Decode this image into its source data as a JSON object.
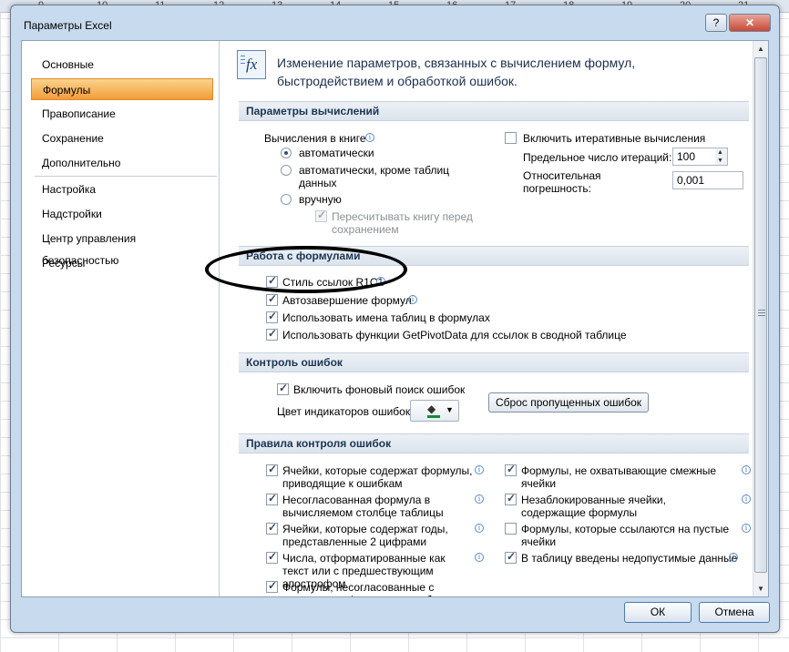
{
  "background": {
    "col_headers": [
      "9",
      "10",
      "11",
      "12",
      "13",
      "14",
      "15",
      "16",
      "17",
      "18",
      "19",
      "20",
      "21"
    ]
  },
  "dialog": {
    "title": "Параметры Excel",
    "help_glyph": "?",
    "close_glyph": "✕"
  },
  "nav": {
    "items": [
      {
        "label": "Основные"
      },
      {
        "label": "Формулы"
      },
      {
        "label": "Правописание"
      },
      {
        "label": "Сохранение"
      },
      {
        "label": "Дополнительно"
      },
      {
        "label": "Настройка"
      },
      {
        "label": "Надстройки"
      },
      {
        "label": "Центр управления безопасностью"
      },
      {
        "label": "Ресурсы"
      }
    ],
    "active": "Формулы"
  },
  "header": {
    "icon": "fx-formula-icon",
    "icon_text": "fx",
    "text": "Изменение параметров, связанных с вычислением формул, быстродействием и обработкой ошибок."
  },
  "calc": {
    "section_title": "Параметры вычислений",
    "workbook_label": "Вычисления в книге",
    "radio_auto": "автоматически",
    "radio_auto_except": "автоматически, кроме таблиц данных",
    "radio_manual": "вручную",
    "recalc_before_save": "Пересчитывать книгу перед сохранением",
    "iterative_label": "Включить итеративные вычисления",
    "max_iter_label": "Предельное число итераций:",
    "max_iter_value": "100",
    "max_change_label": "Относительная погрешность:",
    "max_change_value": "0,001"
  },
  "formulas": {
    "section_title": "Работа с формулами",
    "r1c1_label": "Стиль ссылок R1C1",
    "autocomplete_label": "Автозавершение формул",
    "table_names_label": "Использовать имена таблиц в формулах",
    "getpivot_label": "Использовать функции GetPivotData для ссылок в сводной таблице"
  },
  "errcheck": {
    "section_title": "Контроль ошибок",
    "bg_check_label": "Включить фоновый поиск ошибок",
    "indicator_color_label": "Цвет индикаторов ошибок:",
    "reset_button": "Сброс пропущенных ошибок",
    "indicator_color": "#168a35"
  },
  "rules": {
    "section_title": "Правила контроля ошибок",
    "left": [
      {
        "label": "Ячейки, которые содержат формулы, приводящие к ошибкам"
      },
      {
        "label": "Несогласованная формула в вычисляемом столбце таблицы"
      },
      {
        "label": "Ячейки, которые содержат годы, представленные 2 цифрами"
      },
      {
        "label": "Числа, отформатированные как текст или с предшествующим апострофом"
      },
      {
        "label": "Формулы, несогласованные с остальными формулами в области"
      }
    ],
    "right": [
      {
        "label": "Формулы, не охватывающие смежные ячейки"
      },
      {
        "label": "Незаблокированные ячейки, содержащие формулы"
      },
      {
        "label": "Формулы, которые ссылаются на пустые ячейки"
      },
      {
        "label": "В таблицу введены недопустимые данные"
      }
    ]
  },
  "footer": {
    "ok": "ОК",
    "cancel": "Отмена"
  }
}
